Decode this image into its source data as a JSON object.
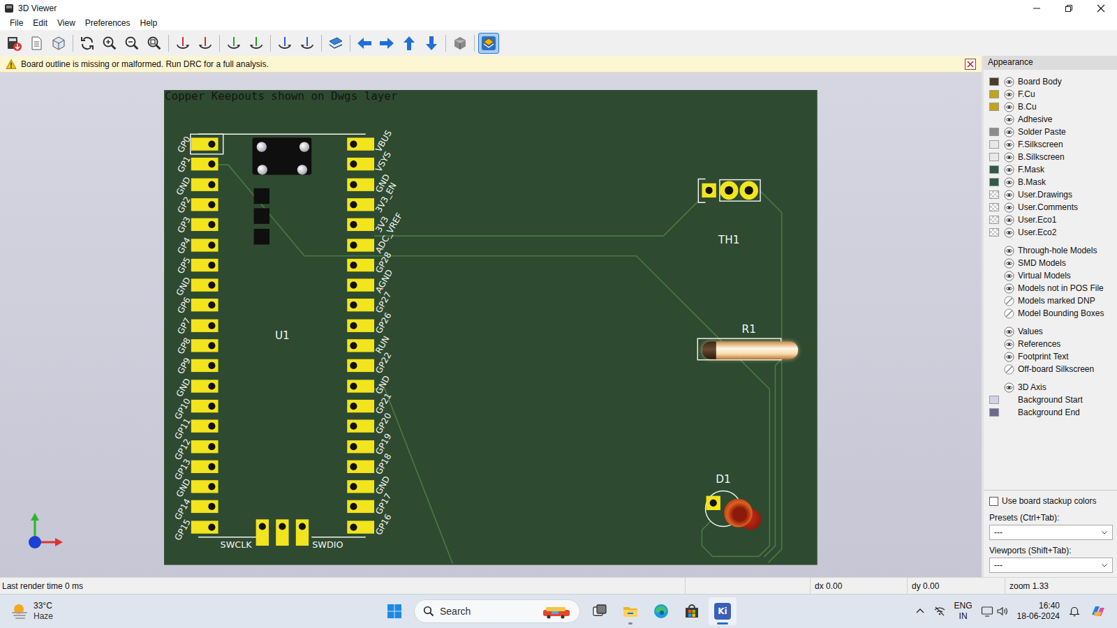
{
  "window": {
    "title": "3D Viewer"
  },
  "menu": [
    "File",
    "Edit",
    "View",
    "Preferences",
    "Help"
  ],
  "toolbar": [
    [
      {
        "kind": "export",
        "selected": false
      },
      {
        "kind": "copy",
        "selected": false
      },
      {
        "kind": "cube",
        "selected": false
      }
    ],
    [
      {
        "kind": "reload",
        "selected": false
      },
      {
        "kind": "zoom-in",
        "selected": false
      },
      {
        "kind": "zoom-out",
        "selected": false
      },
      {
        "kind": "zoom-fit",
        "selected": false
      }
    ],
    [
      {
        "kind": "rotate-x-cw",
        "selected": false
      },
      {
        "kind": "rotate-x-ccw",
        "selected": false
      }
    ],
    [
      {
        "kind": "rotate-y-cw",
        "selected": false
      },
      {
        "kind": "rotate-y-ccw",
        "selected": false
      }
    ],
    [
      {
        "kind": "rotate-z-cw",
        "selected": false
      },
      {
        "kind": "rotate-z-ccw",
        "selected": false
      }
    ],
    [
      {
        "kind": "flip",
        "selected": false
      }
    ],
    [
      {
        "kind": "nav-left",
        "selected": false
      },
      {
        "kind": "nav-right",
        "selected": false
      },
      {
        "kind": "nav-up",
        "selected": false
      },
      {
        "kind": "nav-down",
        "selected": false
      }
    ],
    [
      {
        "kind": "ortho",
        "selected": false
      }
    ],
    [
      {
        "kind": "layers",
        "selected": true
      }
    ]
  ],
  "warning": {
    "text": "Board outline is missing or malformed. Run DRC for a full analysis."
  },
  "board": {
    "note": "Copper Keepouts shown on Dwgs layer",
    "u1": {
      "reference": "U1",
      "left_pins": [
        "GP0",
        "GP1",
        "GND",
        "GP2",
        "GP3",
        "GP4",
        "GP5",
        "GND",
        "GP6",
        "GP7",
        "GP8",
        "GP9",
        "GND",
        "GP10",
        "GP11",
        "GP12",
        "GP13",
        "GND",
        "GP14",
        "GP15"
      ],
      "right_pins": [
        "VBUS",
        "VSYS",
        "GND",
        "3V3_EN",
        "3V3",
        "ADC_VREF",
        "GP28",
        "AGND",
        "GP27",
        "GP26",
        "RUN",
        "GP22",
        "GND",
        "GP21",
        "GP20",
        "GP19",
        "GP18",
        "GND",
        "GP17",
        "GP16"
      ],
      "bottom_labels": [
        "SWCLK",
        "SWDIO"
      ]
    },
    "th1": {
      "reference": "TH1"
    },
    "r1": {
      "reference": "R1"
    },
    "d1": {
      "reference": "D1"
    }
  },
  "appearance": {
    "title": "Appearance",
    "groups": [
      [
        {
          "label": "Board Body",
          "kind": "swatch",
          "color": "#4a3c28",
          "visible": true
        },
        {
          "label": "F.Cu",
          "kind": "swatch",
          "color": "#c2a31c",
          "visible": true
        },
        {
          "label": "B.Cu",
          "kind": "swatch",
          "color": "#c2a31c",
          "visible": true
        },
        {
          "label": "Adhesive",
          "kind": "plain",
          "visible": true
        },
        {
          "label": "Solder Paste",
          "kind": "swatch",
          "color": "#8c8c8c",
          "visible": true
        },
        {
          "label": "F.Silkscreen",
          "kind": "swatch",
          "color": "#e8e8e8",
          "visible": true
        },
        {
          "label": "B.Silkscreen",
          "kind": "swatch",
          "color": "#e8e8e8",
          "visible": true
        },
        {
          "label": "F.Mask",
          "kind": "swatch",
          "color": "#2f5b45",
          "visible": true
        },
        {
          "label": "B.Mask",
          "kind": "swatch",
          "color": "#2f5b45",
          "visible": true
        },
        {
          "label": "User.Drawings",
          "kind": "checker",
          "visible": true
        },
        {
          "label": "User.Comments",
          "kind": "checker",
          "visible": true
        },
        {
          "label": "User.Eco1",
          "kind": "checker",
          "visible": true
        },
        {
          "label": "User.Eco2",
          "kind": "checker",
          "visible": true
        }
      ],
      [
        {
          "label": "Through-hole Models",
          "kind": "plain",
          "visible": true
        },
        {
          "label": "SMD Models",
          "kind": "plain",
          "visible": true
        },
        {
          "label": "Virtual Models",
          "kind": "plain",
          "visible": true
        },
        {
          "label": "Models not in POS File",
          "kind": "plain",
          "visible": true
        },
        {
          "label": "Models marked DNP",
          "kind": "plain",
          "visible": false
        },
        {
          "label": "Model Bounding Boxes",
          "kind": "plain",
          "visible": false
        }
      ],
      [
        {
          "label": "Values",
          "kind": "plain",
          "visible": true
        },
        {
          "label": "References",
          "kind": "plain",
          "visible": true
        },
        {
          "label": "Footprint Text",
          "kind": "plain",
          "visible": true
        },
        {
          "label": "Off-board Silkscreen",
          "kind": "plain",
          "visible": false
        }
      ],
      [
        {
          "label": "3D Axis",
          "kind": "plain",
          "visible": true
        },
        {
          "label": "Background Start",
          "kind": "color",
          "color": "#d2d2ea"
        },
        {
          "label": "Background End",
          "kind": "color",
          "color": "#6b6b8f"
        }
      ]
    ],
    "stackup": {
      "label": "Use board stackup colors",
      "checked": false
    },
    "presets": {
      "label": "Presets (Ctrl+Tab):",
      "value": "---"
    },
    "viewports": {
      "label": "Viewports (Shift+Tab):",
      "value": "---"
    }
  },
  "status_bar": {
    "message": "Last render time 0 ms",
    "dx": "dx 0.00",
    "dy": "dy 0.00",
    "zoom": "zoom 1.33"
  },
  "taskbar": {
    "weather": {
      "temp": "33°C",
      "condition": "Haze"
    },
    "search": {
      "placeholder": "Search"
    },
    "apps": [
      {
        "kind": "task-view",
        "running": false,
        "selected": false
      },
      {
        "kind": "file-explorer",
        "running": true,
        "selected": false
      },
      {
        "kind": "edge",
        "running": false,
        "selected": false
      },
      {
        "kind": "store",
        "running": false,
        "selected": false
      },
      {
        "kind": "kicad",
        "label": "Ki",
        "running": true,
        "selected": true
      }
    ],
    "tray": {
      "language": "ENG",
      "region": "IN",
      "time": "16:40",
      "date": "18-06-2024"
    }
  }
}
